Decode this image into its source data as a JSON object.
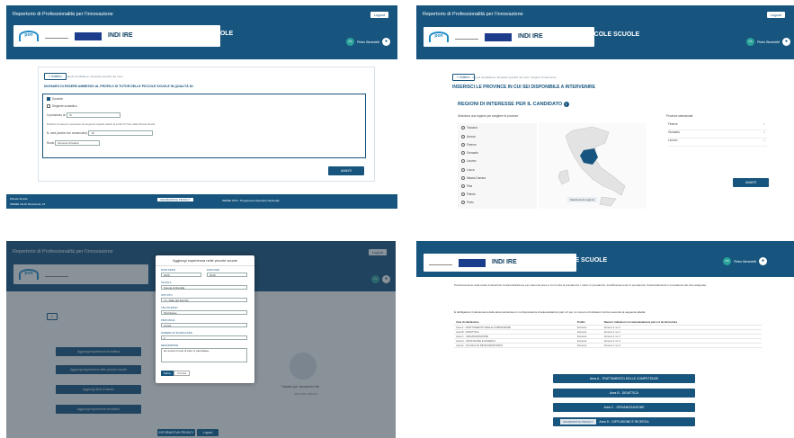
{
  "app": {
    "title": "Repertorio di Professionalità per l'innovazione",
    "login_label": "Logout"
  },
  "logos": {
    "pon": "pon",
    "indire": "INDI\nIRE",
    "piccole": "PICCOLE\nSCUOLE"
  },
  "user": {
    "initials": "PS",
    "name": "Pietro Benedetti"
  },
  "panel1": {
    "back_label": "« Indietro",
    "crumb": "Aspetti candidatura / Requisiti specifici del ruolo",
    "heading": "DICHIARO DI ESSERE AMMESSO AL PROFILO DI TUTOR DELLE PICCOLE SCUOLE IN QUALITÀ DI:",
    "options": [
      {
        "label": "Docente",
        "checked": true
      },
      {
        "label": "Dirigente scolastico",
        "checked": false
      }
    ],
    "in_possesso_label": "In possesso di:",
    "in_possesso_value": "Sì",
    "note": "Dichiaro di essere in possesso dei seguenti requisiti relativi al profilo di Tutor delle Piccole Scuole",
    "anni_label": "N. anni (anche non consecutivi):",
    "anni_value": "10",
    "ruolo_label": "Ruolo",
    "ruolo_value": "Docente di lettere",
    "submit_label": "AVANTI",
    "footer_left": "Piccole Scuole",
    "footer_left2": "INDIRE Via M. Buonarroti, 10",
    "footer_center": "INFORMATIVA PRIVACY",
    "footer_right": "INDIRE PON - Programma Operativo Nazionale"
  },
  "panel2": {
    "back_label": "« Indietro",
    "crumb": "Aspetti candidatura / Requisiti specifici del ruolo / Regioni di intervento",
    "heading": "INSERISCI LE PROVINCE IN CUI SEI DISPONIBILE A INTERVENIRE",
    "subheading": "REGIONI DI INTERESSE PER IL CANDIDATO",
    "select_label": "Seleziona una regione per scegliere le province",
    "selected_label": "Province selezionate",
    "regions": [
      "Toscana",
      "Arezzo",
      "Firenze",
      "Grosseto",
      "Livorno",
      "Lucca",
      "Massa Carrara",
      "Pisa",
      "Pistoia",
      "Prato"
    ],
    "selected": [
      "Firenze",
      "Grosseto",
      "Livorno"
    ],
    "map_caption": "Seleziona la regione",
    "submit_label": "AVANTI"
  },
  "panel3": {
    "modal_title": "Aggiungi esperienza nelle piccole scuole",
    "fields": [
      {
        "label": "DATA INIZIO",
        "value": "2016"
      },
      {
        "label": "DATA FINE",
        "value": "2019"
      },
      {
        "label": "SCUOLA",
        "value": "Scuola di Ramilla"
      },
      {
        "label": "ISTITUTO",
        "value": "I.C. Valle del Serchio"
      },
      {
        "label": "TIPO PLESSO",
        "value": "Pluriclasse"
      },
      {
        "label": "PROVINCIA",
        "value": "Lucca"
      },
      {
        "label": "NUMERO DI PLURICLASSI",
        "value": "2"
      },
      {
        "label": "DESCRIZIONE",
        "value": "Ho svolto il ruolo di tutor in pluriclasse"
      }
    ],
    "save_label": "Salva",
    "cancel_label": "Annulla",
    "buttons": [
      "Aggiungi esperienza formativa",
      "Aggiungi esperienza nelle piccole scuole",
      "Aggiungi titoli di studio",
      "Aggiungi esperienze formative"
    ],
    "upload_text": "Trascina qui i documenti o file",
    "upload_sub": "clicca per caricare",
    "bottom_label": "INFORMATIVA PRIVACY",
    "bottom_right": "Logout"
  },
  "panel4": {
    "intro": "Posizionamento sulla scala di descrittori di autovalutazione per ciascuna area in cui rientra la prevalenza. I valori in prevalenza. Insufficientemente in prevalenza, Sostanzialmente in prevalenza del tutto adeguata.",
    "note": "È obbligatorio il caricamento della documentazione in corrispondenza di autovalutazioni pari a 3 per un numero di indicatori minimo secondo la seguente tabella:",
    "table_head": [
      "Area di valutazione",
      "Profilo",
      "Numero indicatori con autovalutazione pari a 3 da dimostrare"
    ],
    "rows": [
      [
        "Area A - TRATTAMENTO DELLE COMPETENZE",
        "Docente",
        "Almeno 1 su 3"
      ],
      [
        "Area B - DIDATTICA",
        "Docente",
        "Almeno 1 su 3"
      ],
      [
        "Area C - ORGANIZZAZIONE",
        "Docente",
        "Almeno 1 su 3"
      ],
      [
        "Area D - DIFFUSIONE E RICERCA",
        "Docente",
        "Almeno 1 su 3"
      ],
      [
        "Area E - SCUOLA IN RETE/TERRITORIO",
        "Docente",
        "Almeno 1 su 3"
      ]
    ],
    "buttons": [
      "Area A - TRATTAMENTO DELLE COMPETENZE",
      "Area B - DIDATTICA",
      "Area C - ORGANIZZAZIONE",
      "Area D - DIFFUSIONE E RICERCA"
    ],
    "bottom_label": "INFORMATIVA PRIVACY"
  }
}
